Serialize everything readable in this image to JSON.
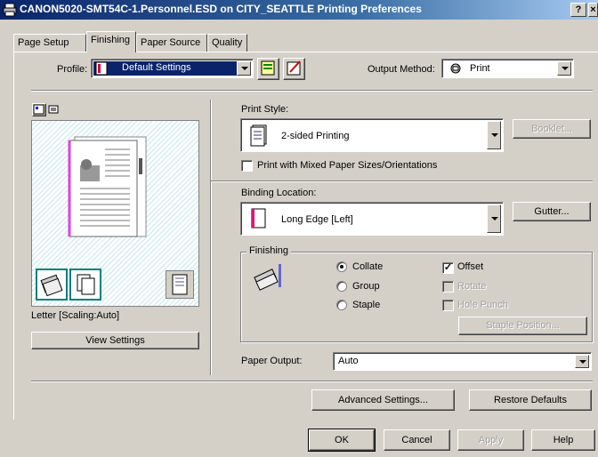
{
  "window": {
    "title": "CANON5020-SMT54C-1.Personnel.ESD on CITY_SEATTLE Printing Preferences",
    "help_glyph": "?",
    "close_glyph": "×"
  },
  "tabs": [
    {
      "label": "Page Setup"
    },
    {
      "label": "Finishing",
      "active": true
    },
    {
      "label": "Paper Source"
    },
    {
      "label": "Quality"
    }
  ],
  "profile": {
    "label": "Profile:",
    "value": "Default Settings"
  },
  "output_method": {
    "label": "Output Method:",
    "value": "Print"
  },
  "preview": {
    "caption": "Letter [Scaling:Auto]",
    "view_settings": "View Settings"
  },
  "print_style": {
    "label": "Print Style:",
    "value": "2-sided Printing",
    "booklet": "Booklet...",
    "mixed_sizes": {
      "label": "Print with Mixed Paper Sizes/Orientations",
      "checked": false
    }
  },
  "binding": {
    "label": "Binding Location:",
    "value": "Long Edge [Left]",
    "gutter": "Gutter..."
  },
  "finishing": {
    "label": "Finishing",
    "collate": {
      "label": "Collate",
      "selected": true
    },
    "group": {
      "label": "Group",
      "selected": false
    },
    "staple": {
      "label": "Staple",
      "selected": false
    },
    "offset": {
      "label": "Offset",
      "checked": true
    },
    "rotate": {
      "label": "Rotate",
      "checked": false,
      "disabled": true
    },
    "hole_punch": {
      "label": "Hole Punch",
      "checked": false,
      "disabled": true
    },
    "staple_position": "Staple Position..."
  },
  "paper_output": {
    "label": "Paper Output:",
    "value": "Auto"
  },
  "buttons": {
    "advanced": "Advanced Settings...",
    "restore": "Restore Defaults",
    "ok": "OK",
    "cancel": "Cancel",
    "apply": "Apply",
    "help": "Help"
  },
  "colors": {
    "title_start": "#0a246a",
    "title_end": "#a6caf0",
    "face": "#d4d0c8"
  }
}
